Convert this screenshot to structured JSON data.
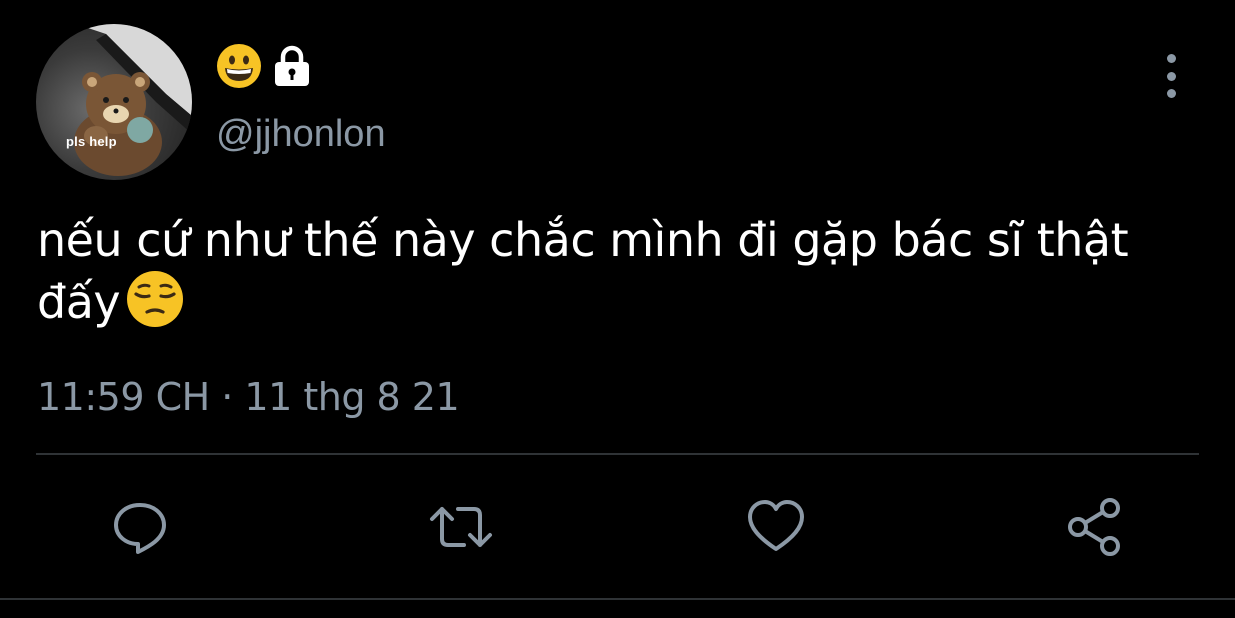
{
  "author": {
    "avatar_caption": "pls help",
    "display_name_icons": [
      "grinning-face-emoji",
      "lock-icon"
    ],
    "handle": "@jjhonlon"
  },
  "tweet": {
    "text": "nếu cứ như thế này chắc mình đi gặp bác sĩ thật đấy",
    "trailing_emoji": "pensive-face-emoji",
    "timestamp": "11:59 CH · 11 thg 8 21"
  },
  "actions": [
    {
      "name": "reply",
      "icon": "speech-bubble-icon"
    },
    {
      "name": "retweet",
      "icon": "retweet-icon"
    },
    {
      "name": "like",
      "icon": "heart-icon"
    },
    {
      "name": "share",
      "icon": "share-icon"
    }
  ],
  "colors": {
    "background": "#000000",
    "text_primary": "#ffffff",
    "text_secondary": "#8b98a5",
    "divider": "#2f3336"
  }
}
